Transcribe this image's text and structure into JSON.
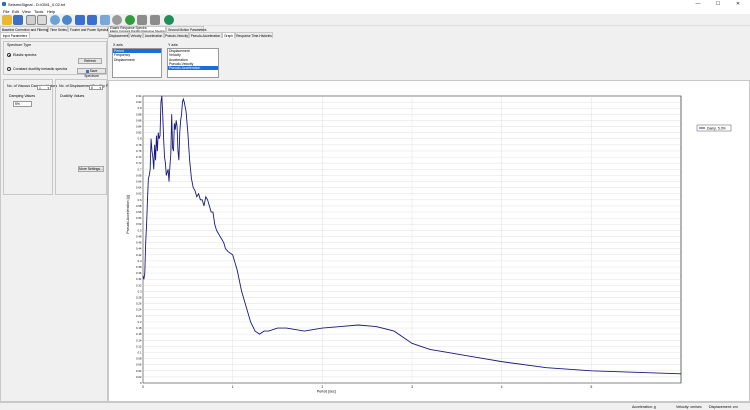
{
  "window": {
    "title": "SeismoSignal - D:\\GM1_0.02.txt",
    "minimize": "—",
    "maximize": "☐",
    "close": "✕"
  },
  "menu": [
    "File",
    "Edit",
    "View",
    "Tools",
    "Help"
  ],
  "toolbar_icons": [
    "open-folder-icon",
    "save-icon",
    "copy-icon",
    "export-icon",
    "zoom-in-icon",
    "zoom-out-icon",
    "arrow-down-icon",
    "arrow-up-icon",
    "graph-settings-icon",
    "settings-icon",
    "help-icon",
    "tools-icon",
    "tools-2-icon",
    "web-icon"
  ],
  "tabs_main": [
    "Baseline Correction and Filtering",
    "Time Series",
    "Fourier and Power Spectra",
    "Elastic Response Spectra"
  ],
  "tabs_main_extra": [
    "Elastic Constant Ductility Response Spectra",
    "Ground Motion Parameters"
  ],
  "tabs_sub": [
    "Input Parameters",
    "Displacement",
    "Velocity",
    "Acceleration",
    "Pseudo-Velocity",
    "Pseudo-Acceleration",
    "Graph",
    "Response Time-Histories"
  ],
  "left": {
    "spectrum_type_label": "Spectrum Type",
    "radio_elastic": "Elastic spectra",
    "radio_constant": "Constant ductility inelastic spectra",
    "refresh_button": "Refresh",
    "save_spectrum_button": "Save Spectrum",
    "no_viscous_label": "No. of Viscous Damping Values",
    "no_viscous_value": "1",
    "damping_values_label": "Damping Values",
    "damping_value": "5%",
    "no_displacement_label": "No. of Displacement Ductility Factors",
    "no_displacement_value": "0",
    "ductility_values_label": "Ductility Values",
    "more_settings_button": "More Settings..."
  },
  "xaxis_list": {
    "label": "X axis",
    "items": [
      "Period",
      "Frequency",
      "Displacement"
    ],
    "selected": 0
  },
  "yaxis_list": {
    "label": "Y axis",
    "items": [
      "Displacement",
      "Velocity",
      "Acceleration",
      "Pseudo-Velocity",
      "Pseudo-Acceleration"
    ],
    "selected": 4
  },
  "status": {
    "acceleration": "Acceleration: g",
    "velocity": "Velocity: cm/sec",
    "displacement": "Displacement: cm"
  },
  "colors": {
    "series": "#1a1a7a",
    "selection": "#1b6ed6"
  },
  "chart_data": {
    "type": "line",
    "xlabel": "Period [sec]",
    "ylabel": "Pseudo-Acceleration [g]",
    "xlim": [
      0,
      6
    ],
    "ylim": [
      0,
      0.94
    ],
    "xticks": [
      0,
      1,
      2,
      3,
      4,
      5
    ],
    "ytick_step": 0.02,
    "grid": true,
    "legend": "right",
    "series": [
      {
        "name": "Damp. 5.0%",
        "x": [
          0.0,
          0.01,
          0.02,
          0.03,
          0.04,
          0.05,
          0.06,
          0.07,
          0.08,
          0.09,
          0.1,
          0.11,
          0.12,
          0.13,
          0.14,
          0.15,
          0.16,
          0.17,
          0.18,
          0.19,
          0.2,
          0.21,
          0.22,
          0.23,
          0.24,
          0.25,
          0.26,
          0.27,
          0.28,
          0.29,
          0.3,
          0.31,
          0.32,
          0.33,
          0.34,
          0.35,
          0.36,
          0.37,
          0.38,
          0.39,
          0.4,
          0.41,
          0.42,
          0.43,
          0.44,
          0.45,
          0.46,
          0.48,
          0.5,
          0.52,
          0.54,
          0.56,
          0.58,
          0.6,
          0.62,
          0.64,
          0.66,
          0.68,
          0.7,
          0.72,
          0.74,
          0.76,
          0.78,
          0.8,
          0.82,
          0.84,
          0.86,
          0.88,
          0.9,
          0.92,
          0.95,
          1.0,
          1.05,
          1.1,
          1.15,
          1.2,
          1.25,
          1.3,
          1.35,
          1.4,
          1.5,
          1.6,
          1.7,
          1.8,
          1.9,
          2.0,
          2.2,
          2.4,
          2.6,
          2.8,
          3.0,
          3.2,
          3.4,
          3.6,
          3.8,
          4.0,
          4.5,
          5.0,
          5.5,
          6.0
        ],
        "y": [
          0.35,
          0.34,
          0.36,
          0.46,
          0.52,
          0.6,
          0.67,
          0.68,
          0.7,
          0.8,
          0.76,
          0.74,
          0.7,
          0.78,
          0.73,
          0.81,
          0.76,
          0.82,
          0.8,
          0.81,
          0.92,
          0.94,
          0.88,
          0.8,
          0.74,
          0.72,
          0.68,
          0.69,
          0.7,
          0.66,
          0.71,
          0.75,
          0.88,
          0.77,
          0.76,
          0.85,
          0.83,
          0.86,
          0.84,
          0.76,
          0.73,
          0.82,
          0.86,
          0.88,
          0.92,
          0.93,
          0.92,
          0.89,
          0.82,
          0.73,
          0.67,
          0.64,
          0.63,
          0.61,
          0.62,
          0.6,
          0.6,
          0.58,
          0.61,
          0.6,
          0.58,
          0.56,
          0.56,
          0.52,
          0.5,
          0.49,
          0.48,
          0.47,
          0.46,
          0.44,
          0.43,
          0.42,
          0.37,
          0.3,
          0.25,
          0.2,
          0.17,
          0.16,
          0.17,
          0.17,
          0.18,
          0.18,
          0.175,
          0.17,
          0.175,
          0.18,
          0.185,
          0.19,
          0.185,
          0.17,
          0.13,
          0.11,
          0.1,
          0.09,
          0.08,
          0.07,
          0.05,
          0.04,
          0.035,
          0.03
        ]
      }
    ]
  }
}
